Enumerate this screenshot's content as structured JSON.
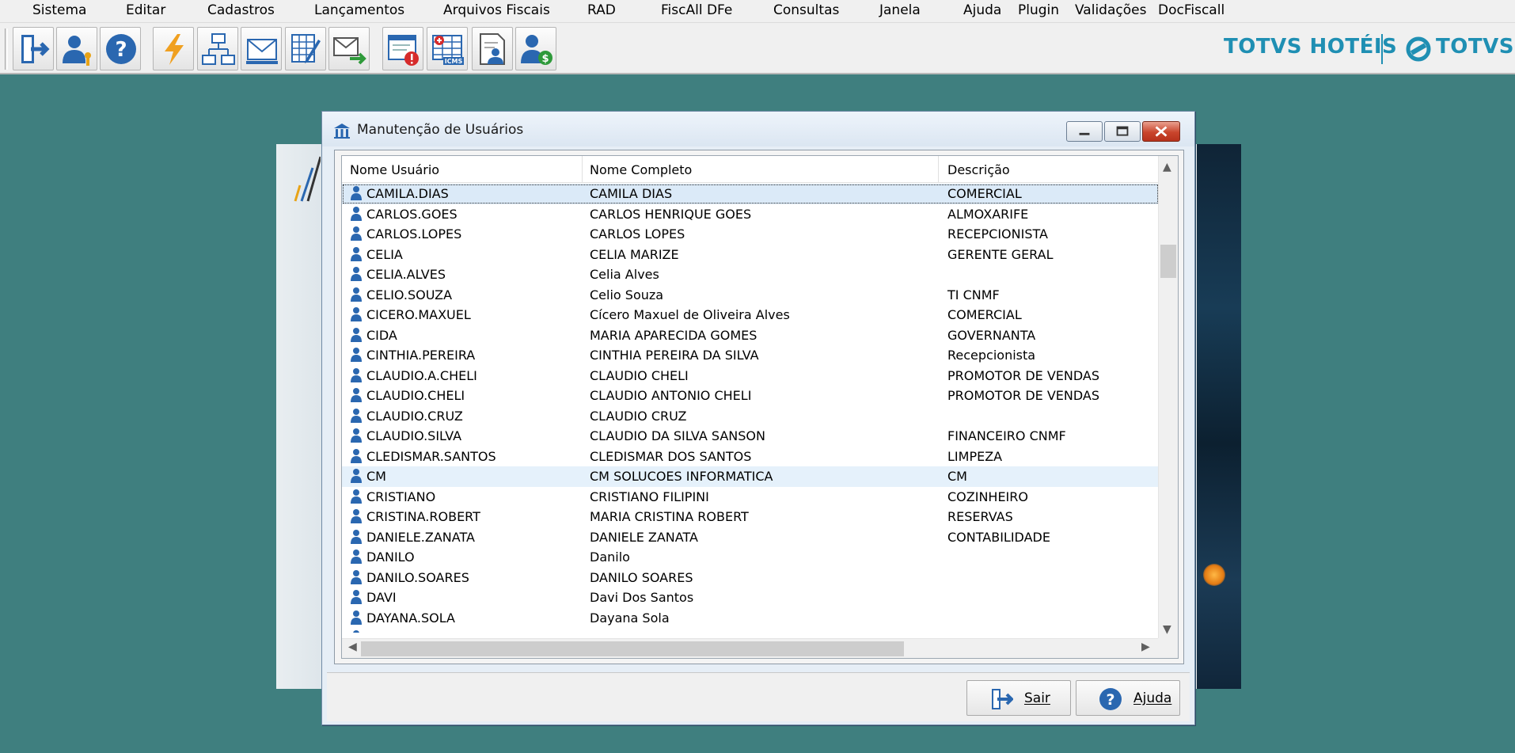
{
  "menu": [
    "Sistema",
    "Editar",
    "Cadastros",
    "Lançamentos",
    "Arquivos Fiscais",
    "RAD",
    "FiscAll DFe",
    "Consultas",
    "Janela",
    "Ajuda",
    "Plugin",
    "Validações",
    "DocFiscall"
  ],
  "toolbar": {
    "icons": [
      "exit-icon",
      "user-key-icon",
      "help-icon",
      "lightning-icon",
      "hierarchy-icon",
      "envelope-icon",
      "grid-edit-icon",
      "send-mail-icon",
      "alert-window-icon",
      "icms-table-icon",
      "document-user-icon",
      "user-money-icon"
    ],
    "brand_left": "TOTVS HOTÉIS",
    "brand_right": "TOTVS",
    "brand_color": "#1f8fb3"
  },
  "dialog": {
    "title": "Manutenção de Usuários",
    "columns": [
      "Nome Usuário",
      "Nome Completo",
      "Descrição"
    ],
    "rows": [
      {
        "user": "CAMILA.DIAS",
        "full": "CAMILA DIAS",
        "desc": "COMERCIAL"
      },
      {
        "user": "CARLOS.GOES",
        "full": "CARLOS HENRIQUE GOES",
        "desc": "ALMOXARIFE"
      },
      {
        "user": "CARLOS.LOPES",
        "full": "CARLOS LOPES",
        "desc": "RECEPCIONISTA"
      },
      {
        "user": "CELIA",
        "full": "CELIA MARIZE",
        "desc": "GERENTE GERAL"
      },
      {
        "user": "CELIA.ALVES",
        "full": "Celia Alves",
        "desc": ""
      },
      {
        "user": "CELIO.SOUZA",
        "full": "Celio Souza",
        "desc": "TI CNMF"
      },
      {
        "user": "CICERO.MAXUEL",
        "full": "Cícero Maxuel de Oliveira Alves",
        "desc": "COMERCIAL"
      },
      {
        "user": "CIDA",
        "full": "MARIA APARECIDA GOMES",
        "desc": "GOVERNANTA"
      },
      {
        "user": "CINTHIA.PEREIRA",
        "full": "CINTHIA PEREIRA DA SILVA",
        "desc": "Recepcionista"
      },
      {
        "user": "CLAUDIO.A.CHELI",
        "full": "CLAUDIO CHELI",
        "desc": "PROMOTOR DE VENDAS"
      },
      {
        "user": "CLAUDIO.CHELI",
        "full": "CLAUDIO ANTONIO CHELI",
        "desc": "PROMOTOR DE VENDAS"
      },
      {
        "user": "CLAUDIO.CRUZ",
        "full": "CLAUDIO CRUZ",
        "desc": ""
      },
      {
        "user": "CLAUDIO.SILVA",
        "full": "CLAUDIO DA SILVA SANSON",
        "desc": "FINANCEIRO CNMF"
      },
      {
        "user": "CLEDISMAR.SANTOS",
        "full": "CLEDISMAR DOS SANTOS",
        "desc": "LIMPEZA"
      },
      {
        "user": "CM",
        "full": "CM SOLUCOES INFORMATICA",
        "desc": "CM"
      },
      {
        "user": "CRISTIANO",
        "full": "CRISTIANO FILIPINI",
        "desc": "COZINHEIRO"
      },
      {
        "user": "CRISTINA.ROBERT",
        "full": "MARIA CRISTINA ROBERT",
        "desc": "RESERVAS"
      },
      {
        "user": "DANIELE.ZANATA",
        "full": "DANIELE ZANATA",
        "desc": "CONTABILIDADE"
      },
      {
        "user": "DANILO",
        "full": "Danilo",
        "desc": ""
      },
      {
        "user": "DANILO.SOARES",
        "full": "DANILO SOARES",
        "desc": ""
      },
      {
        "user": "DAVI",
        "full": "Davi Dos Santos",
        "desc": ""
      },
      {
        "user": "DAYANA.SOLA",
        "full": "Dayana Sola",
        "desc": ""
      },
      {
        "user": "DCA",
        "full": "DCA",
        "desc": "DCA"
      }
    ],
    "selected_row": 0,
    "hover_row": 14,
    "buttons": {
      "exit": "Sair",
      "help": "Ajuda"
    }
  }
}
